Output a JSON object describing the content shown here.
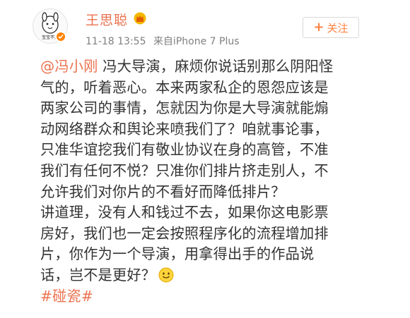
{
  "user": {
    "name": "王思聪",
    "avatar_caption": "宝宝不开",
    "verified_color": "#ff8200"
  },
  "post_meta": {
    "time": "11-18 13:55",
    "source": "来自iPhone 7 Plus"
  },
  "follow_button": {
    "icon": "+",
    "label": "关注"
  },
  "post": {
    "mention": "@冯小刚",
    "lines": [
      " 冯大导演，麻烦你说话别那么阴阳怪",
      "气的，听着恶心。本来两家私企的恩怨应该是",
      "两家公司的事情，怎就因为你是大导演就能煽",
      "动网络群众和舆论来喷我们了？咱就事论事，",
      "只准华谊挖我们有敬业协议在身的高管，不准",
      "我们有任何不悦？只准你们排片挤走别人，不",
      "允许我们对你片的不看好而降低排片？",
      "讲道理，没有人和钱过不去，如果你这电影票",
      "房好，我们也一定会按照程序化的流程增加排",
      "片，你作为一个导演，用拿得出手的作品说",
      "话，岂不是更好？"
    ],
    "emoji": "smile-emoji",
    "topic": "#碰瓷#"
  }
}
